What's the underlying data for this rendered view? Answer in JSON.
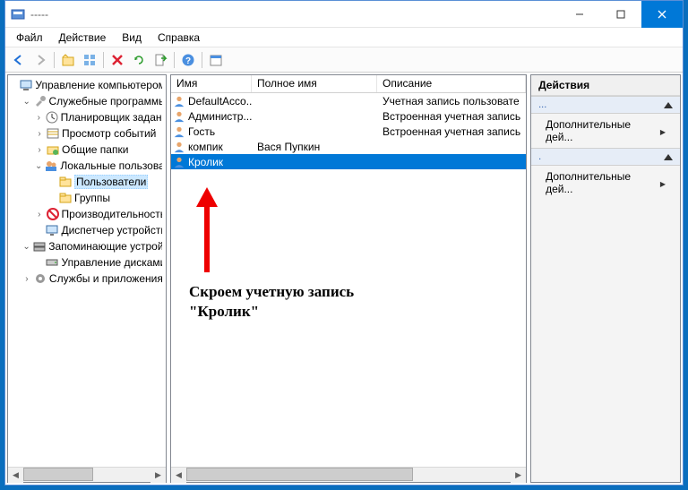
{
  "title": "-----",
  "menubar": {
    "file": "Файл",
    "action": "Действие",
    "view": "Вид",
    "help": "Справка"
  },
  "toolbar_icons": [
    "back",
    "forward",
    "up",
    "grid",
    "delete",
    "refresh",
    "export",
    "help",
    "calendar"
  ],
  "tree": {
    "root": "Управление компьютером (л",
    "system_tools": "Служебные программы",
    "scheduler": "Планировщик заданий",
    "event_viewer": "Просмотр событий",
    "shared": "Общие папки",
    "local_users": "Локальные пользовате",
    "users": "Пользователи",
    "groups": "Группы",
    "performance": "Производительность",
    "device_mgr": "Диспетчер устройств",
    "storage": "Запоминающие устройс",
    "disk_mgmt": "Управление дисками",
    "services": "Службы и приложения"
  },
  "list": {
    "columns": {
      "name": "Имя",
      "fullname": "Полное имя",
      "desc": "Описание"
    },
    "rows": [
      {
        "name": "DefaultAcco...",
        "fullname": "",
        "desc": "Учетная запись пользовате",
        "selected": false
      },
      {
        "name": "Администр...",
        "fullname": "",
        "desc": "Встроенная учетная запись",
        "selected": false
      },
      {
        "name": "Гость",
        "fullname": "",
        "desc": "Встроенная учетная запись",
        "selected": false
      },
      {
        "name": "компик",
        "fullname": "Вася Пупкин",
        "desc": "",
        "selected": false
      },
      {
        "name": "Кролик",
        "fullname": "",
        "desc": "",
        "selected": true
      }
    ]
  },
  "annotation": "Скроем учетную запись \"Кролик\"",
  "actions": {
    "header": "Действия",
    "group1": "...",
    "item1": "Дополнительные дей...",
    "group2": ".",
    "item2": "Дополнительные дей..."
  }
}
